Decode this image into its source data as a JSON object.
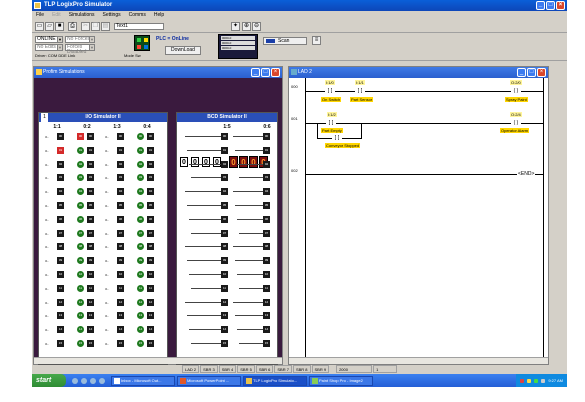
{
  "window": {
    "title": "TLP LogixPro Simulator"
  },
  "menu": [
    "File",
    "Edit",
    "Simulations",
    "Settings",
    "Comms",
    "Help"
  ],
  "toolbar": {
    "file_field": "Text1"
  },
  "mode": {
    "online": "ONLINE",
    "no_forces": "No Forces",
    "forces_disabled": "Forces Disabled",
    "driver": "Driver: COM DDE Link",
    "mode_sw": "Mode Sw",
    "no_edits": "No Edits"
  },
  "plc": {
    "status": "PLC = OnLine",
    "download": "DownLoad"
  },
  "memmap": [
    "0000-0",
    "0000-0",
    "0000-0"
  ],
  "scan": {
    "label": "Scan"
  },
  "profim": {
    "title": "Profim Simulations"
  },
  "io_sim": {
    "title": "I/O Simulator II",
    "page": "1",
    "groups": [
      "1:1",
      "0:2",
      "1:3",
      "0:4"
    ],
    "lamp_labels": [
      "00",
      "01",
      "02",
      "03",
      "04",
      "05",
      "06",
      "07",
      "08",
      "09",
      "10",
      "11",
      "12",
      "13",
      "14",
      "15"
    ]
  },
  "bcd_sim": {
    "title": "BCD Simulator II",
    "groups": [
      "1:5",
      "0:6"
    ],
    "inputs": [
      "0",
      "0",
      "0",
      "0"
    ],
    "outputs": [
      "0",
      "0",
      "0",
      "0"
    ],
    "lamp_labels": [
      "00",
      "01",
      "02",
      "03",
      "04",
      "05",
      "06",
      "07",
      "08",
      "09",
      "10",
      "11",
      "12",
      "13",
      "14",
      "15"
    ]
  },
  "ladder": {
    "title": "LAD 2",
    "rungs": [
      {
        "num": "000",
        "contacts": [
          {
            "addr": "I:1/0",
            "name": "On Switch"
          },
          {
            "addr": "I:1/1",
            "name": "Part Sensor"
          }
        ],
        "output": {
          "addr": "O:2/0",
          "name": "Spray Paint"
        }
      },
      {
        "num": "001",
        "contacts": [
          {
            "addr": "I:1/2",
            "name": "Part Empty"
          },
          {
            "addr": "I:1/3",
            "name": "Conveyor Stopped"
          }
        ],
        "output": {
          "addr": "O:2/4",
          "name": "Operator Alarm"
        }
      },
      {
        "num": "002",
        "end": "END"
      }
    ]
  },
  "status": {
    "tabs": [
      "LAD 2",
      "SBR 3",
      "SBR 4",
      "SBR 5",
      "SBR 6",
      "SBR 7",
      "SBR 8",
      "SBR 9"
    ],
    "count": "2000",
    "zero": "1"
  },
  "taskbar": {
    "start": "start",
    "tasks": [
      "Inbox - Microsoft Out...",
      "Microsoft PowerPoint ...",
      "TLP LogixPro Simulato...",
      "Paint Shop Pro - Image2"
    ],
    "clock": "9:27 AM"
  },
  "colors": {
    "title_blue": "#0d46b8",
    "rung_tag": "#ffd600",
    "bcd_out": "#7a0e0e"
  }
}
